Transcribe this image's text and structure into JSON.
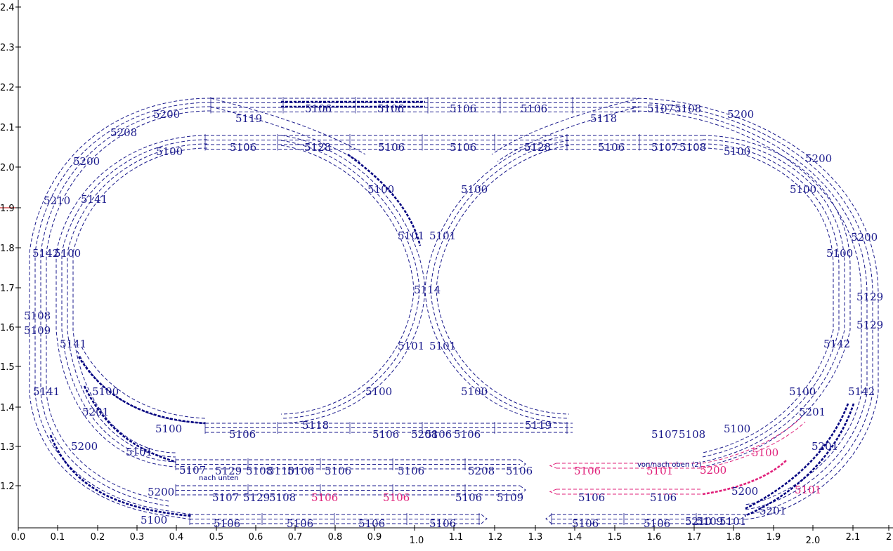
{
  "axes": {
    "x_ticks": [
      "0.0",
      "0.1",
      "0.2",
      "0.3",
      "0.4",
      "0.5",
      "0.6",
      "0.7",
      "0.8",
      "0.9",
      "1.0",
      "1.1",
      "1.2",
      "1.3",
      "1.4",
      "1.5",
      "1.6",
      "1.7",
      "1.8",
      "1.9",
      "2.0",
      "2.1",
      "2"
    ],
    "y_ticks": [
      "2.4",
      "2.3",
      "2.2",
      "2.1",
      "2.0",
      "1.9",
      "1.8",
      "1.7",
      "1.6",
      "1.5",
      "1.4",
      "1.3",
      "1.2"
    ]
  },
  "notes": {
    "down": "nach unten",
    "updown": "von/nach oben (2)"
  },
  "colors": {
    "track": "#1a1a8c",
    "highlight": "#000080",
    "pink": "#e0207a"
  },
  "labels": [
    "5106",
    "5106",
    "5106",
    "5106",
    "5107",
    "5108",
    "5200",
    "5119",
    "5118",
    "5208",
    "5100",
    "5106",
    "5128",
    "5106",
    "5106",
    "5128",
    "5106",
    "5107",
    "5108",
    "5100",
    "5200",
    "5200",
    "5100",
    "5100",
    "5100",
    "5210",
    "5141",
    "5101",
    "5101",
    "5142",
    "5100",
    "5200",
    "5100",
    "5114",
    "5129",
    "5108",
    "5129",
    "5109",
    "5101",
    "5101",
    "5141",
    "5142",
    "5100",
    "5100",
    "5100",
    "5100",
    "5141",
    "5200",
    "5142",
    "5201",
    "5201",
    "5118",
    "5119",
    "5100",
    "5100",
    "5106",
    "5106",
    "5208",
    "5106",
    "5106",
    "5107",
    "5108",
    "5100",
    "5200",
    "5101",
    "5107",
    "5129",
    "5108",
    "5110",
    "5106",
    "5106",
    "5106",
    "5208",
    "5106",
    "5106",
    "5101",
    "5200",
    "5201",
    "5200",
    "5107",
    "5129",
    "5108",
    "5106",
    "5106",
    "5106",
    "5109",
    "5106",
    "5106",
    "5200",
    "5101",
    "5100",
    "5106",
    "5106",
    "5106",
    "5106",
    "5106",
    "5106",
    "5210",
    "5109",
    "5101",
    "5201"
  ]
}
